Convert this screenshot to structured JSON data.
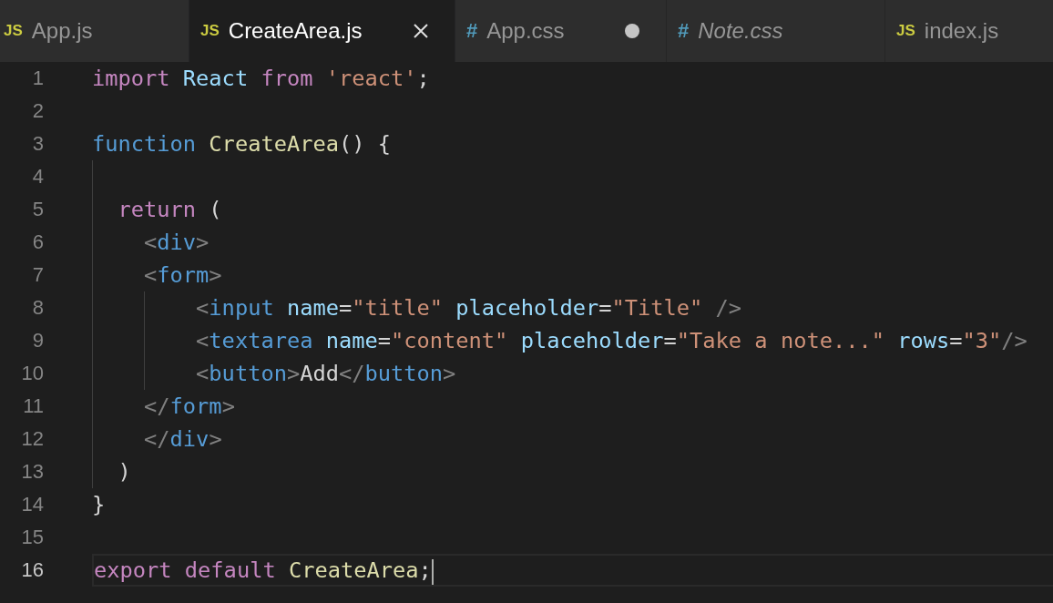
{
  "tabs": [
    {
      "icon": "JS",
      "kind": "js",
      "label": "App.js",
      "selected": false,
      "modified": false,
      "preview": false
    },
    {
      "icon": "JS",
      "kind": "js",
      "label": "CreateArea.js",
      "selected": true,
      "modified": false,
      "preview": false
    },
    {
      "icon": "#",
      "kind": "css",
      "label": "App.css",
      "selected": false,
      "modified": true,
      "preview": false
    },
    {
      "icon": "#",
      "kind": "css",
      "label": "Note.css",
      "selected": false,
      "modified": false,
      "preview": true
    },
    {
      "icon": "JS",
      "kind": "js",
      "label": "index.js",
      "selected": false,
      "modified": false,
      "preview": false
    }
  ],
  "lines": [
    {
      "number": "1",
      "current": false,
      "tokens": [
        {
          "text": "import",
          "kind": "keyword"
        },
        {
          "text": " React",
          "kind": "variable"
        },
        {
          "text": " from",
          "kind": "keyword"
        },
        {
          "text": " 'react'",
          "kind": "string"
        },
        {
          "text": ";",
          "kind": "punct"
        }
      ]
    },
    {
      "number": "2",
      "current": false
    },
    {
      "number": "3",
      "current": false,
      "tokens": [
        {
          "text": "function",
          "kind": "storage"
        },
        {
          "text": " CreateArea",
          "kind": "function"
        },
        {
          "text": "() {",
          "kind": "punct"
        }
      ]
    },
    {
      "number": "4",
      "current": false
    },
    {
      "number": "5",
      "current": false,
      "tokens": [
        {
          "text": "  return",
          "kind": "keyword"
        },
        {
          "text": " (",
          "kind": "punct"
        }
      ]
    },
    {
      "number": "6",
      "current": false,
      "tokens": [
        {
          "text": "    <",
          "kind": "bracket"
        },
        {
          "text": "div",
          "kind": "tag"
        },
        {
          "text": ">",
          "kind": "bracket"
        }
      ]
    },
    {
      "number": "7",
      "current": false,
      "tokens": [
        {
          "text": "    <",
          "kind": "bracket"
        },
        {
          "text": "form",
          "kind": "tag"
        },
        {
          "text": ">",
          "kind": "bracket"
        }
      ]
    },
    {
      "number": "8",
      "current": false,
      "tokens": [
        {
          "text": "        <",
          "kind": "bracket"
        },
        {
          "text": "input",
          "kind": "tag"
        },
        {
          "text": " name",
          "kind": "attr"
        },
        {
          "text": "=",
          "kind": "punct"
        },
        {
          "text": "\"title\"",
          "kind": "string"
        },
        {
          "text": " placeholder",
          "kind": "attr"
        },
        {
          "text": "=",
          "kind": "punct"
        },
        {
          "text": "\"Title\"",
          "kind": "string"
        },
        {
          "text": " />",
          "kind": "bracket"
        }
      ]
    },
    {
      "number": "9",
      "current": false,
      "tokens": [
        {
          "text": "        <",
          "kind": "bracket"
        },
        {
          "text": "textarea",
          "kind": "tag"
        },
        {
          "text": " name",
          "kind": "attr"
        },
        {
          "text": "=",
          "kind": "punct"
        },
        {
          "text": "\"content\"",
          "kind": "string"
        },
        {
          "text": " placeholder",
          "kind": "attr"
        },
        {
          "text": "=",
          "kind": "punct"
        },
        {
          "text": "\"Take a note...\"",
          "kind": "string"
        },
        {
          "text": " rows",
          "kind": "attr"
        },
        {
          "text": "=",
          "kind": "punct"
        },
        {
          "text": "\"3\"",
          "kind": "string"
        },
        {
          "text": "/>",
          "kind": "bracket"
        }
      ]
    },
    {
      "number": "10",
      "current": false,
      "tokens": [
        {
          "text": "        <",
          "kind": "bracket"
        },
        {
          "text": "button",
          "kind": "tag"
        },
        {
          "text": ">",
          "kind": "bracket"
        },
        {
          "text": "Add",
          "kind": "text"
        },
        {
          "text": "</",
          "kind": "bracket"
        },
        {
          "text": "button",
          "kind": "tag"
        },
        {
          "text": ">",
          "kind": "bracket"
        }
      ]
    },
    {
      "number": "11",
      "current": false,
      "tokens": [
        {
          "text": "    </",
          "kind": "bracket"
        },
        {
          "text": "form",
          "kind": "tag"
        },
        {
          "text": ">",
          "kind": "bracket"
        }
      ]
    },
    {
      "number": "12",
      "current": false,
      "tokens": [
        {
          "text": "    </",
          "kind": "bracket"
        },
        {
          "text": "div",
          "kind": "tag"
        },
        {
          "text": ">",
          "kind": "bracket"
        }
      ]
    },
    {
      "number": "13",
      "current": false,
      "tokens": [
        {
          "text": "  )",
          "kind": "punct"
        }
      ]
    },
    {
      "number": "14",
      "current": false,
      "tokens": [
        {
          "text": "}",
          "kind": "punct"
        }
      ]
    },
    {
      "number": "15",
      "current": false
    },
    {
      "number": "16",
      "current": true,
      "tokens": [
        {
          "text": "export",
          "kind": "keyword"
        },
        {
          "text": " default",
          "kind": "keyword"
        },
        {
          "text": " CreateArea",
          "kind": "function"
        },
        {
          "text": ";",
          "kind": "punct"
        }
      ]
    }
  ]
}
